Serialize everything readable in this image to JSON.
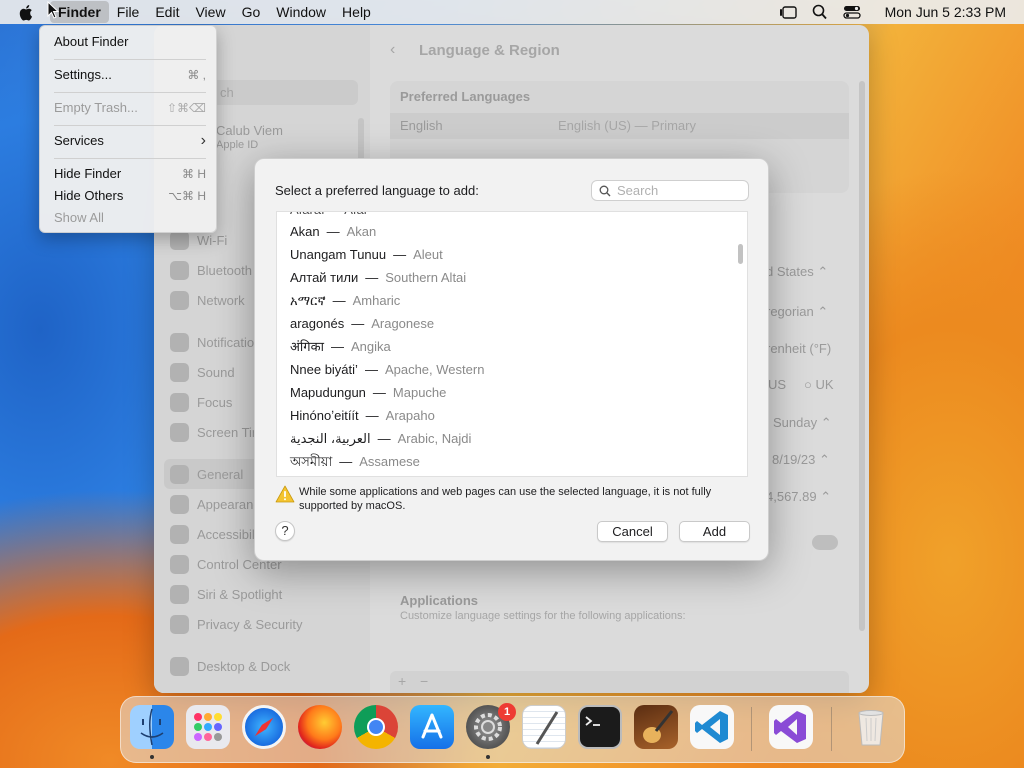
{
  "menubar": {
    "items": [
      "Finder",
      "File",
      "Edit",
      "View",
      "Go",
      "Window",
      "Help"
    ],
    "clock": "Mon Jun 5  2:33 PM",
    "icons": [
      "apple-icon",
      "stage-manager-icon",
      "spotlight-icon",
      "control-center-icon"
    ]
  },
  "finder_menu": {
    "about": "About Finder",
    "settings": "Settings...",
    "settings_shortcut": "⌘ ,",
    "empty_trash": "Empty Trash...",
    "empty_trash_shortcut": "⇧⌘⌫",
    "services": "Services",
    "services_arrow": "›",
    "hide_finder": "Hide Finder",
    "hide_finder_shortcut": "⌘ H",
    "hide_others": "Hide Others",
    "hide_others_shortcut": "⌥⌘ H",
    "show_all": "Show All"
  },
  "settings_window": {
    "title": "Language & Region",
    "search_placeholder": "ch",
    "account_name": "Calub Viem",
    "account_sub": "Apple ID",
    "sidebar": [
      "Wi-Fi",
      "Bluetooth",
      "Network",
      "Notifications",
      "Sound",
      "Focus",
      "Screen Time",
      "General",
      "Appearance",
      "Accessibility",
      "Control Center",
      "Siri & Spotlight",
      "Privacy & Security",
      "Desktop & Dock"
    ],
    "preferred_languages_header": "Preferred Languages",
    "lang_primary": "English",
    "lang_primary_detail": "English (US) — Primary",
    "region": "d States",
    "calendar": "regorian",
    "temperature": "renheit (°F)",
    "measure_us": "US",
    "measure_uk": "UK",
    "first_day": "Sunday",
    "date_format": "8/19/23",
    "number_format": "4,567.89",
    "applications_header": "Applications",
    "applications_sub": "Customize language settings for the following applications:",
    "plus": "+",
    "minus": "−"
  },
  "language_sheet": {
    "prompt": "Select a preferred language to add:",
    "search_placeholder": "Search",
    "partial_row": "Afaraf — Afar",
    "languages": [
      {
        "native": "Akan",
        "english": "Akan"
      },
      {
        "native": "Unangam Tunuu",
        "english": "Aleut"
      },
      {
        "native": "Алтай тили",
        "english": "Southern Altai"
      },
      {
        "native": "አማርኛ",
        "english": "Amharic"
      },
      {
        "native": "aragonés",
        "english": "Aragonese"
      },
      {
        "native": "अंगिका",
        "english": "Angika"
      },
      {
        "native": "Nnee biyáti’",
        "english": "Apache, Western"
      },
      {
        "native": "Mapudungun",
        "english": "Mapuche"
      },
      {
        "native": "Hinónoʼeitíít",
        "english": "Arapaho"
      },
      {
        "native": "العربية، النجدية",
        "english": "Arabic, Najdi"
      },
      {
        "native": "অসমীয়া",
        "english": "Assamese"
      }
    ],
    "warning": "While some applications and web pages can use the selected language, it is not fully supported by macOS.",
    "help": "?",
    "cancel": "Cancel",
    "add": "Add"
  },
  "dock": {
    "apps": [
      "Finder",
      "Launchpad",
      "Safari",
      "Firefox",
      "Chrome",
      "App Store",
      "System Settings",
      "TextEdit",
      "Terminal",
      "Instruments",
      "Visual Studio Code",
      "Visual Studio",
      "Trash"
    ],
    "settings_badge": "1"
  },
  "colors": {
    "accent": "#0a84ff",
    "badge": "#ee3b33",
    "warning": "#f4c430"
  }
}
